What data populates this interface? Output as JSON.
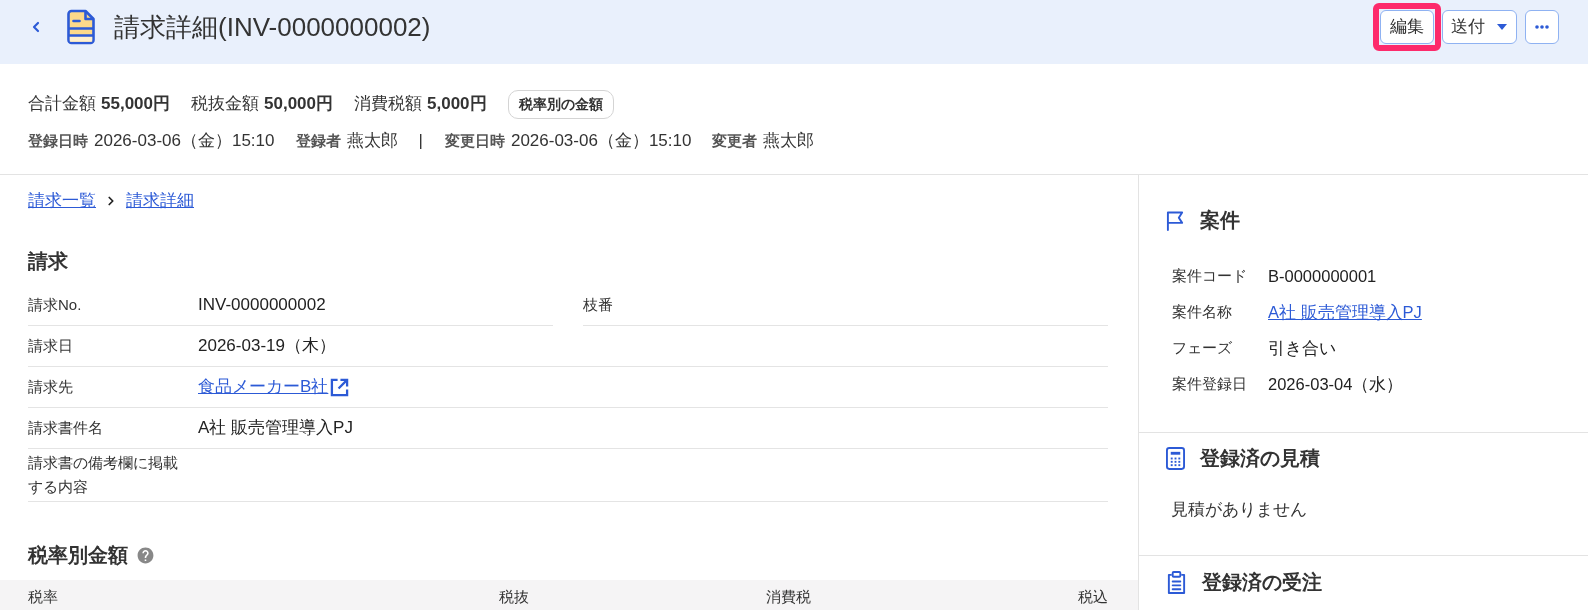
{
  "header": {
    "title": "請求詳細(INV-0000000002)",
    "actions": [
      {
        "kind": "button",
        "label": "編集",
        "highlighted": true
      },
      {
        "kind": "dropdown",
        "label": "送付",
        "highlighted": false
      },
      {
        "kind": "more",
        "highlighted": false
      }
    ]
  },
  "summary": {
    "amounts": [
      {
        "label": "合計金額",
        "value": "55,000円"
      },
      {
        "label": "税抜金額",
        "value": "50,000円"
      },
      {
        "label": "消費税額",
        "value": "5,000円"
      }
    ],
    "tax_button": "税率別の金額",
    "meta": [
      {
        "kind": "field",
        "label": "登録日時",
        "value": "2026-03-06（金）15:10"
      },
      {
        "kind": "field",
        "label": "登録者",
        "value": "燕太郎"
      },
      {
        "kind": "separator",
        "text": "|"
      },
      {
        "kind": "field",
        "label": "変更日時",
        "value": "2026-03-06（金）15:10"
      },
      {
        "kind": "field",
        "label": "変更者",
        "value": "燕太郎"
      }
    ]
  },
  "breadcrumb": [
    {
      "label": "請求一覧"
    },
    {
      "label": "請求詳細"
    }
  ],
  "invoice": {
    "title": "請求",
    "rows": [
      {
        "cells": [
          {
            "kind": "text",
            "label": "請求No.",
            "value": "INV-0000000002"
          },
          {
            "kind": "empty",
            "label": "枝番"
          }
        ]
      },
      {
        "cells": [
          {
            "kind": "text",
            "label": "請求日",
            "value": "2026-03-19（木）"
          }
        ]
      },
      {
        "cells": [
          {
            "kind": "link",
            "label": "請求先",
            "value": "食品メーカーB社"
          }
        ]
      },
      {
        "cells": [
          {
            "kind": "text",
            "label": "請求書件名",
            "value": "A社 販売管理導入PJ"
          }
        ]
      },
      {
        "cells": [
          {
            "kind": "empty",
            "label": "請求書の備考欄に掲載する内容"
          }
        ]
      }
    ]
  },
  "tax_breakdown": {
    "title": "税率別金額",
    "columns": [
      "税率",
      "税抜",
      "消費税",
      "税込"
    ]
  },
  "sidebar": {
    "sections": [
      {
        "kind": "project",
        "title": "案件",
        "fields": [
          {
            "kind": "text",
            "label": "案件コード",
            "value": "B-0000000001"
          },
          {
            "kind": "link",
            "label": "案件名称",
            "value": "A社 販売管理導入PJ"
          },
          {
            "kind": "text",
            "label": "フェーズ",
            "value": "引き合い"
          },
          {
            "kind": "text",
            "label": "案件登録日",
            "value": "2026-03-04（水）"
          }
        ]
      },
      {
        "kind": "estimates",
        "title": "登録済の見積",
        "empty_text": "見積がありません"
      },
      {
        "kind": "orders",
        "title": "登録済の受注"
      }
    ]
  }
}
